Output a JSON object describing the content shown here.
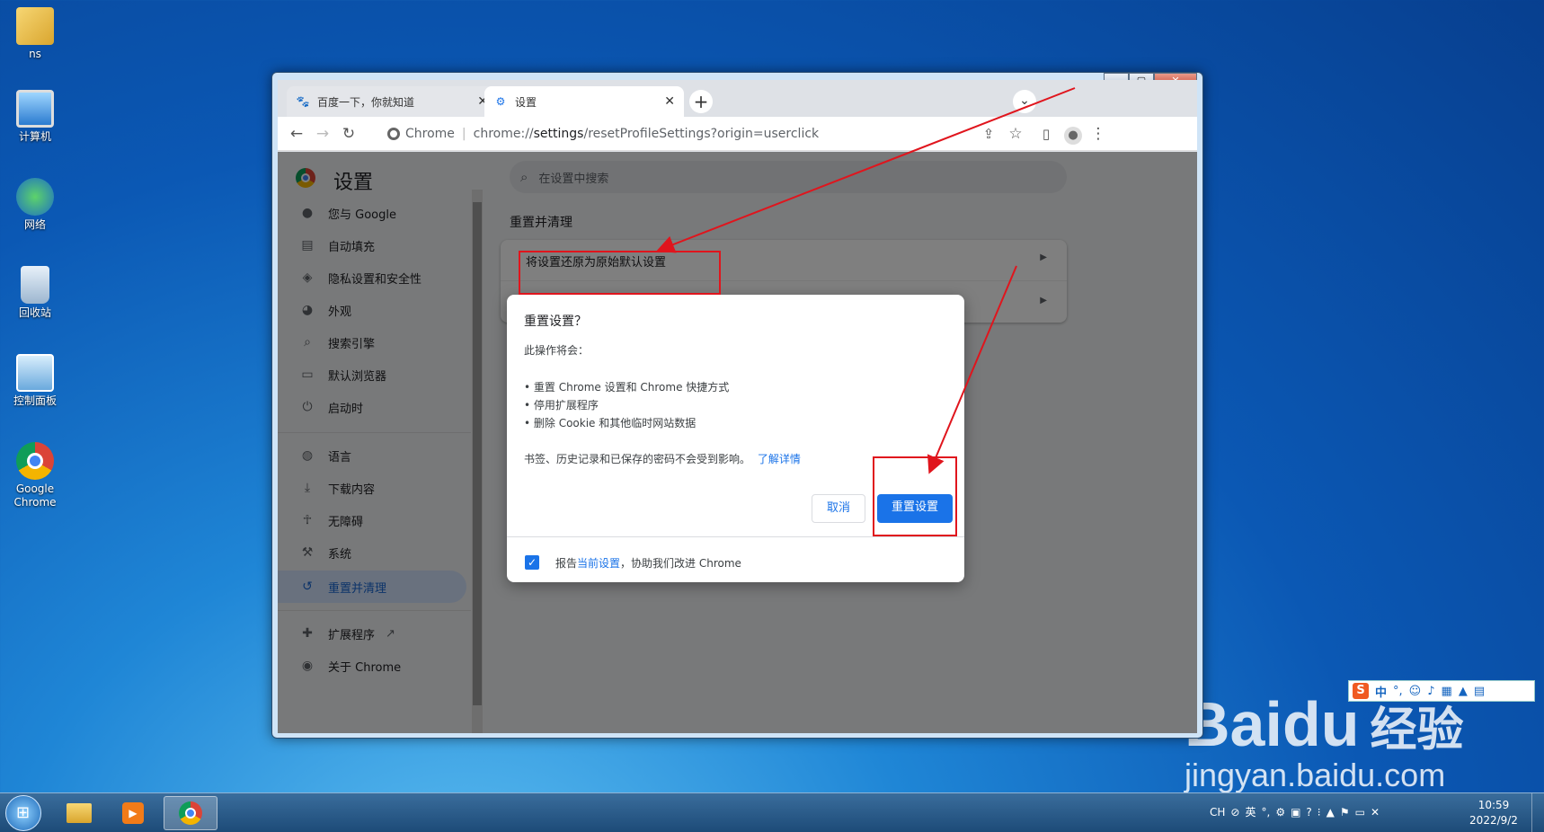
{
  "desktop": {
    "icons": [
      {
        "label": "ns",
        "icon": "user-folder-icon"
      },
      {
        "label": "计算机",
        "icon": "computer-icon"
      },
      {
        "label": "网络",
        "icon": "network-icon"
      },
      {
        "label": "回收站",
        "icon": "recycle-bin-icon"
      },
      {
        "label": "控制面板",
        "icon": "control-panel-icon"
      },
      {
        "label": "Google Chrome",
        "icon": "chrome-icon"
      }
    ],
    "watermark": {
      "brand1": "Bai",
      "brand2": "du",
      "brand3": "经验",
      "url": "jingyan.baidu.com"
    },
    "ime": {
      "mode": "中"
    }
  },
  "browser": {
    "tabs": [
      {
        "title": "百度一下，你就知道",
        "icon": "baidu-paw-icon",
        "active": false
      },
      {
        "title": "设置",
        "icon": "gear-icon",
        "active": true
      }
    ],
    "omnibox": {
      "site_label": "Chrome",
      "url_prefix": "chrome://",
      "url_path": "settings",
      "url_rest": "/resetProfileSettings?origin=userclick"
    }
  },
  "settings": {
    "title": "设置",
    "search_placeholder": "在设置中搜索",
    "nav": [
      {
        "label": "您与 Google",
        "icon": "person-icon"
      },
      {
        "label": "自动填充",
        "icon": "clipboard-icon"
      },
      {
        "label": "隐私设置和安全性",
        "icon": "shield-icon"
      },
      {
        "label": "外观",
        "icon": "palette-icon"
      },
      {
        "label": "搜索引擎",
        "icon": "search-icon"
      },
      {
        "label": "默认浏览器",
        "icon": "browser-icon"
      },
      {
        "label": "启动时",
        "icon": "power-icon"
      },
      {
        "label": "语言",
        "icon": "globe-icon"
      },
      {
        "label": "下载内容",
        "icon": "download-icon"
      },
      {
        "label": "无障碍",
        "icon": "accessibility-icon"
      },
      {
        "label": "系统",
        "icon": "wrench-icon"
      },
      {
        "label": "重置并清理",
        "icon": "history-icon",
        "active": true
      },
      {
        "label": "扩展程序",
        "icon": "puzzle-icon"
      },
      {
        "label": "关于 Chrome",
        "icon": "chrome-icon"
      }
    ],
    "section_title": "重置并清理",
    "row1": "将设置还原为原始默认设置"
  },
  "dialog": {
    "title": "重置设置？",
    "intro": "此操作将会：",
    "bullets": [
      "• 重置 Chrome 设置和 Chrome 快捷方式",
      "• 停用扩展程序",
      "• 删除 Cookie 和其他临时网站数据"
    ],
    "note": "书签、历史记录和已保存的密码不会受到影响。",
    "learn_more": "了解详情",
    "cancel": "取消",
    "confirm": "重置设置",
    "report_pre": "报告",
    "report_link": "当前设置",
    "report_post": "，协助我们改进 Chrome",
    "report_checked": true
  },
  "taskbar": {
    "lang": "CH",
    "ime_lang": "英",
    "time": "10:59",
    "date": "2022/9/2"
  },
  "colors": {
    "accent": "#1a73e8",
    "annotation": "#e0151d"
  }
}
